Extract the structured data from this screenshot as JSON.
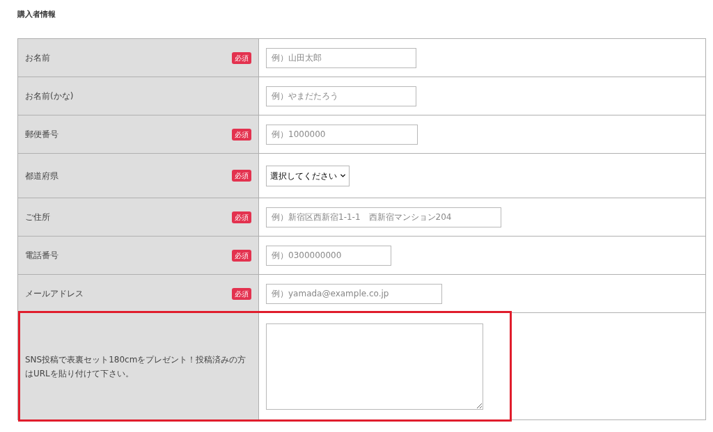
{
  "section_title": "購入者情報",
  "rows": [
    {
      "label": "お名前",
      "badge": "必須",
      "field": {
        "kind": "text",
        "placeholder": "例）山田太郎"
      },
      "highlighted": false
    },
    {
      "label": "お名前(かな)",
      "field": {
        "kind": "text",
        "placeholder": "例）やまだたろう"
      },
      "highlighted": false
    },
    {
      "label": "郵便番号",
      "badge": "必須",
      "field": {
        "kind": "text",
        "placeholder": "例）1000000"
      },
      "highlighted": false
    },
    {
      "label": "都道府県",
      "badge": "必須",
      "field": {
        "kind": "select",
        "value": "選択してください"
      },
      "highlighted": false
    },
    {
      "label": "ご住所",
      "badge": "必須",
      "field": {
        "kind": "text",
        "placeholder": "例）新宿区西新宿1-1-1　西新宿マンション204"
      },
      "highlighted": false
    },
    {
      "label": "電話番号",
      "badge": "必須",
      "field": {
        "kind": "text",
        "placeholder": "例）0300000000"
      },
      "highlighted": false
    },
    {
      "label": "メールアドレス",
      "badge": "必須",
      "field": {
        "kind": "text",
        "placeholder": "例）yamada@example.co.jp"
      },
      "highlighted": false
    },
    {
      "label": "SNS投稿で表裏セット180cmをプレゼント！投稿済みの方はURLを貼り付けて下さい。",
      "field": {
        "kind": "textarea"
      },
      "highlighted": true
    }
  ]
}
